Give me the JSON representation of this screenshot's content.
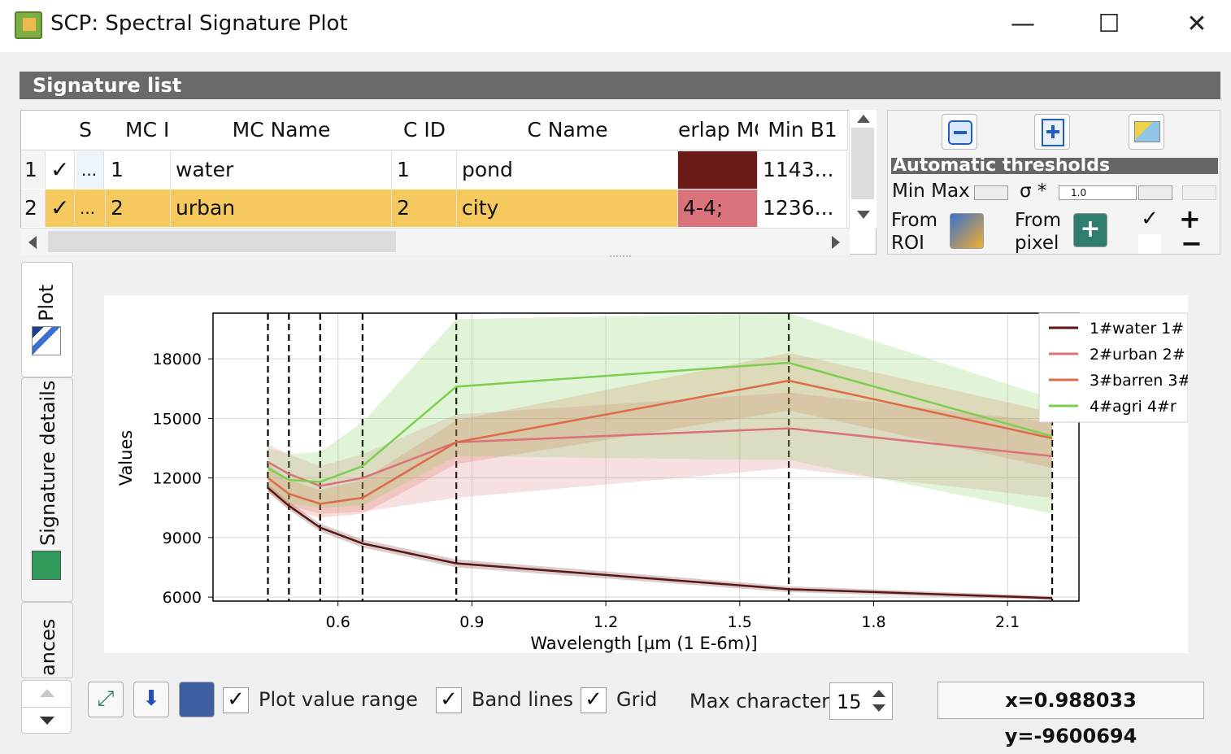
{
  "window": {
    "title": "SCP: Spectral Signature Plot",
    "minimize": "—",
    "maximize": "☐",
    "close": "✕"
  },
  "signature_list": {
    "header": "Signature list",
    "columns": [
      "S",
      "MC ID",
      "MC Name",
      "C ID",
      "C Name",
      "erlap MC",
      "Min B1"
    ],
    "rows": [
      {
        "num": "1",
        "check": "✓",
        "dots": "...",
        "mc_id": "1",
        "mc_name": "water",
        "c_id": "1",
        "c_name": "pond",
        "overlap": "",
        "overlap_color": "#6b1a17",
        "min_b1": "1143..."
      },
      {
        "num": "2",
        "check": "✓",
        "dots": "...",
        "mc_id": "2",
        "mc_name": "urban",
        "c_id": "2",
        "c_name": "city",
        "overlap": "4-4;",
        "overlap_color": "#d9727a",
        "min_b1": "1236..."
      }
    ]
  },
  "thresholds": {
    "header": "Automatic thresholds",
    "min_max": "Min Max",
    "sigma": "σ *",
    "sigma_value": "1.0",
    "from_roi": "From",
    "from_roi2": "ROI",
    "from_pixel": "From",
    "from_pixel2": "pixel",
    "plus": "+",
    "minus": "−",
    "check": "✓"
  },
  "tabs": {
    "plot": "Plot",
    "signature_details": "Signature details",
    "distances": "ances"
  },
  "bottom": {
    "plot_value_range": "Plot value range",
    "band_lines": "Band lines",
    "grid": "Grid",
    "max_characters": "Max characters",
    "max_characters_value": "15",
    "coords": "x=0.988033 y=-9600694",
    "check": "✓"
  },
  "colors": {
    "water": "#5a1616",
    "urban": "#d9727a",
    "barren": "#dd6a48",
    "agri": "#7ccf4f",
    "highlight": "#f6c95f"
  },
  "chart_data": {
    "type": "line",
    "xlabel": "Wavelength [µm (1 E-6m)]",
    "ylabel": "Values",
    "xlim": [
      0.32,
      2.26
    ],
    "ylim": [
      5800,
      20300
    ],
    "xticks": [
      0.6,
      0.9,
      1.2,
      1.5,
      1.8,
      2.1
    ],
    "yticks": [
      6000,
      9000,
      12000,
      15000,
      18000
    ],
    "band_lines": [
      0.443,
      0.49,
      0.56,
      0.655,
      0.865,
      1.61,
      2.2
    ],
    "grid": true,
    "legend_position": "top-right",
    "x": [
      0.443,
      0.49,
      0.56,
      0.655,
      0.865,
      1.61,
      2.2
    ],
    "series": [
      {
        "name": "1#water 1#",
        "color": "#5a1616",
        "values": [
          11500,
          10600,
          9500,
          8700,
          7700,
          6400,
          5950
        ],
        "lo": [
          11300,
          10400,
          9300,
          8500,
          7500,
          6250,
          5850
        ],
        "hi": [
          11700,
          10800,
          9700,
          8900,
          7900,
          6550,
          6050
        ]
      },
      {
        "name": "2#urban 2#",
        "color": "#d9727a",
        "values": [
          12800,
          12200,
          11600,
          12000,
          13800,
          14500,
          13100
        ],
        "lo": [
          11400,
          10600,
          10200,
          10300,
          11000,
          12500,
          11000
        ],
        "hi": [
          13700,
          13200,
          12600,
          13200,
          15200,
          16300,
          14800
        ]
      },
      {
        "name": "3#barren 3#",
        "color": "#dd6a48",
        "values": [
          12000,
          11200,
          10700,
          11000,
          13800,
          16900,
          14000
        ],
        "lo": [
          11300,
          10400,
          10000,
          10200,
          12700,
          15400,
          12500
        ],
        "hi": [
          12700,
          11900,
          11400,
          11900,
          14900,
          18300,
          15300
        ]
      },
      {
        "name": "4#agri 4#r",
        "color": "#7ccf4f",
        "values": [
          12500,
          11900,
          11800,
          12600,
          16600,
          17800,
          14100
        ],
        "lo": [
          11500,
          10700,
          10500,
          10600,
          13100,
          12900,
          10200
        ],
        "hi": [
          13500,
          13200,
          13300,
          14800,
          20000,
          20300,
          16000
        ]
      }
    ]
  }
}
